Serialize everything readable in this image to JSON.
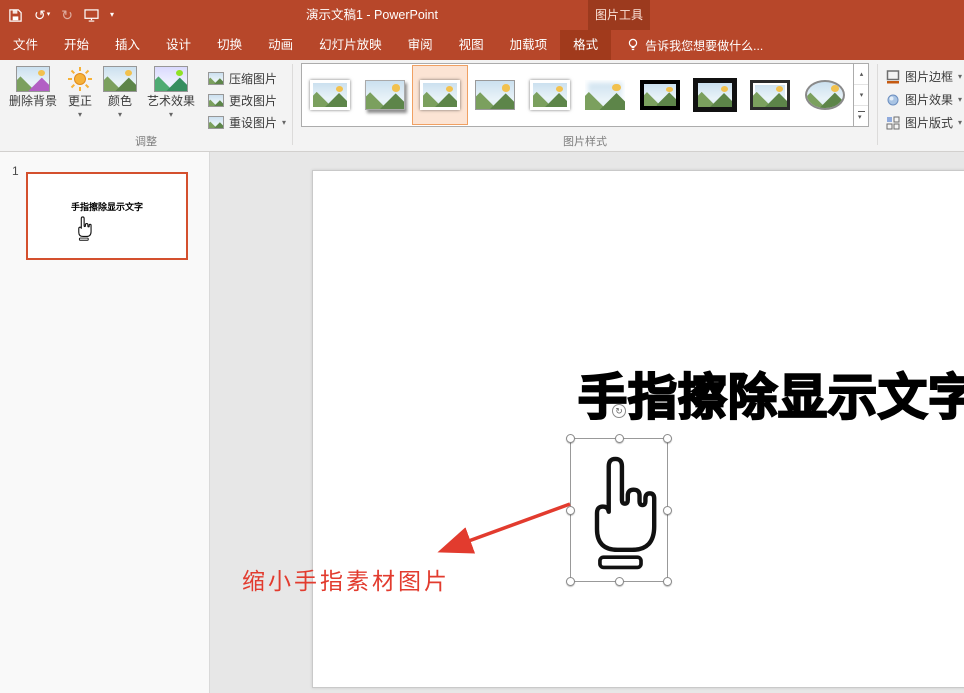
{
  "titlebar": {
    "title": "演示文稿1 - PowerPoint",
    "context_group": "图片工具"
  },
  "tabs": [
    "文件",
    "开始",
    "插入",
    "设计",
    "切换",
    "动画",
    "幻灯片放映",
    "审阅",
    "视图",
    "加载项",
    "格式"
  ],
  "tell_me": "告诉我您想要做什么...",
  "ribbon": {
    "adjust": {
      "label": "调整",
      "remove_bg": "删除背景",
      "corrections": "更正",
      "color": "颜色",
      "artistic": "艺术效果",
      "compress": "压缩图片",
      "change": "更改图片",
      "reset": "重设图片"
    },
    "styles": {
      "label": "图片样式"
    },
    "right": {
      "border": "图片边框",
      "effects": "图片效果",
      "layout": "图片版式"
    }
  },
  "slides_panel": {
    "slide_number": "1",
    "thumbnail_title": "手指擦除显示文字"
  },
  "slide": {
    "title": "手指擦除显示文字",
    "annotation": "缩小手指素材图片"
  },
  "glyphs": {
    "undo": "↺",
    "redo": "↻",
    "dropdown": "▾",
    "scroll_up": "▴",
    "scroll_down": "▾",
    "more": "▾",
    "rotate": "↻"
  },
  "colors": {
    "brand": "#B7472A",
    "brand_dark": "#9C3A1E",
    "annotation_red": "#E23B2E",
    "selection_orange": "#D4502E"
  }
}
